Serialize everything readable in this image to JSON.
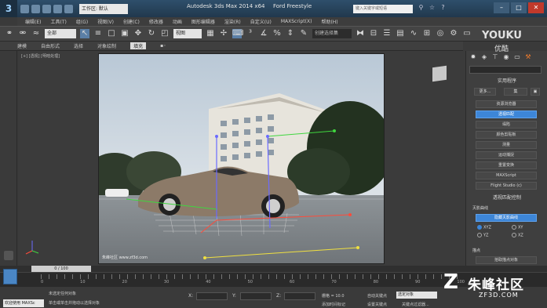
{
  "titlebar": {
    "workspace": "工作区: 默认",
    "title": "Autodesk 3ds Max  2014 x64",
    "file": "Ford Freestyle",
    "search_placeholder": "键入关键字或短语"
  },
  "menubar": {
    "items": [
      "编辑(E)",
      "工具(T)",
      "组(G)",
      "视图(V)",
      "创建(C)",
      "修改器",
      "动画",
      "图形编辑器",
      "渲染(R)",
      "自定义(U)",
      "MAXScript(X)",
      "帮助(H)"
    ]
  },
  "toolbar": {
    "filter": "全部",
    "view_select": "视图",
    "named_set": "创建选择集"
  },
  "ribbon": {
    "tabs": [
      "建模",
      "自由形式",
      "选择",
      "对象绘制",
      "填充"
    ],
    "active": "填充"
  },
  "viewport": {
    "label": "[+] [透视] [明暗处理]",
    "watermark": "朱峰社区 www.zf3d.com"
  },
  "cmdpanel": {
    "utilities_title": "实用程序",
    "more_label": "更多...",
    "sets_label": "集",
    "buttons": [
      "资源浏览器",
      "透视匹配",
      "塌陷",
      "颜色剪贴板",
      "测量",
      "运动捕捉",
      "重置变换",
      "MAXScript",
      "Flight Studio (c)"
    ],
    "active_button": "透视匹配",
    "rollout2_title": "透视匹配控制",
    "rollout2_section": "灭影曲线",
    "hide_button": "隐藏灭影曲线",
    "radios": [
      "XYZ",
      "XY",
      "YZ",
      "XZ",
      "YZ"
    ],
    "section3": "描点",
    "section3_button": "拾取描点对象"
  },
  "timeline": {
    "counter": "0 / 100",
    "ticks": [
      "0",
      "10",
      "20",
      "30",
      "40",
      "50",
      "60",
      "70",
      "80",
      "90",
      "100"
    ]
  },
  "status": {
    "welcome": "欢迎使用 MAXSc",
    "line1": "未选定任何对象",
    "line2": "单击或单击并拖动以选择对象",
    "x_label": "X:",
    "y_label": "Y:",
    "z_label": "Z:",
    "grid": "栅格 = 10.0",
    "add_time_tag": "添加时间标记",
    "auto_key": "自动关键点",
    "selected": "选定对象",
    "set_key": "设置关键点",
    "key_filters": "关键点过滤器..."
  },
  "watermarks": {
    "youku": "YOUKU",
    "youku_sub": "优酷",
    "site_name": "朱峰社区",
    "site_url": "ZF3D.COM"
  }
}
